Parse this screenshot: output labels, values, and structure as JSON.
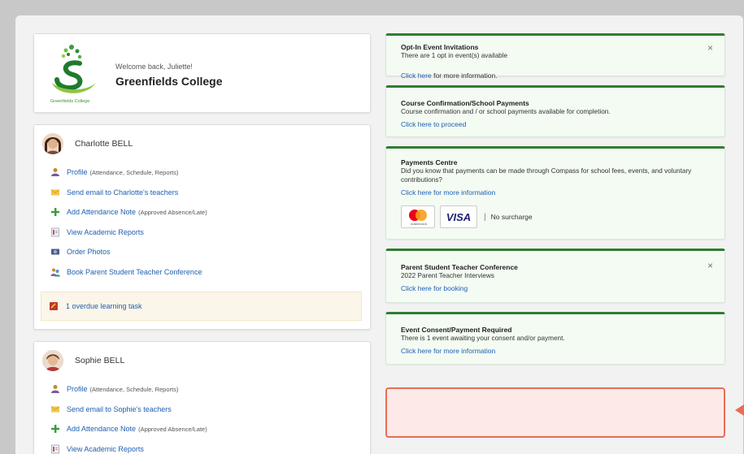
{
  "school": {
    "welcome": "Welcome back, Juliette!",
    "name": "Greenfields College",
    "logo_caption": "Greenfields College"
  },
  "students": [
    {
      "name": "Charlotte BELL",
      "links": [
        {
          "icon": "profile-icon",
          "text": "Profile",
          "note": "(Attendance, Schedule, Reports)"
        },
        {
          "icon": "email-icon",
          "text": "Send email to Charlotte's teachers",
          "note": ""
        },
        {
          "icon": "plus-icon",
          "text": "Add Attendance Note",
          "note": "(Approved Absence/Late)"
        },
        {
          "icon": "report-icon",
          "text": "View Academic Reports",
          "note": ""
        },
        {
          "icon": "photo-icon",
          "text": "Order Photos",
          "note": ""
        },
        {
          "icon": "conference-icon",
          "text": "Book Parent Student Teacher Conference",
          "note": ""
        }
      ],
      "overdue": "1 overdue learning task"
    },
    {
      "name": "Sophie BELL",
      "links": [
        {
          "icon": "profile-icon",
          "text": "Profile",
          "note": "(Attendance, Schedule, Reports)"
        },
        {
          "icon": "email-icon",
          "text": "Send email to Sophie's teachers",
          "note": ""
        },
        {
          "icon": "plus-icon",
          "text": "Add Attendance Note",
          "note": "(Approved Absence/Late)"
        },
        {
          "icon": "report-icon",
          "text": "View Academic Reports",
          "note": ""
        }
      ]
    }
  ],
  "notices": [
    {
      "title": "Opt-In Event Invitations",
      "body": "There are 1 opt in event(s) available",
      "link": "Click here",
      "after": " for more information.",
      "closable": true
    },
    {
      "title": "Course Confirmation/School Payments",
      "body": "Course confirmation and / or school payments available for completion.",
      "link": "Click here to proceed",
      "after": "",
      "closable": false
    },
    {
      "title": "Payments Centre",
      "body": "Did you know that payments can be made through Compass for school fees, events, and voluntary contributions?",
      "link": "Click here for more information",
      "after": "",
      "closable": false,
      "payments": {
        "visa": "VISA",
        "mastercard_caption": "mastercard",
        "separator": "|",
        "surcharge": "No surcharge"
      }
    },
    {
      "title": "Parent Student Teacher Conference",
      "body": "2022 Parent Teacher Interviews",
      "link": "Click here for booking",
      "after": "",
      "closable": true
    },
    {
      "title": "Event Consent/Payment Required",
      "body": "There is 1 event awaiting your consent and/or payment.",
      "link": "Click here for more information",
      "after": "",
      "closable": false
    }
  ],
  "close_glyph": "×",
  "colors": {
    "accent_green": "#2e7d32",
    "link_blue": "#1f5fb0",
    "alert_border": "#e86d55",
    "alert_fill": "#fdeae8"
  }
}
